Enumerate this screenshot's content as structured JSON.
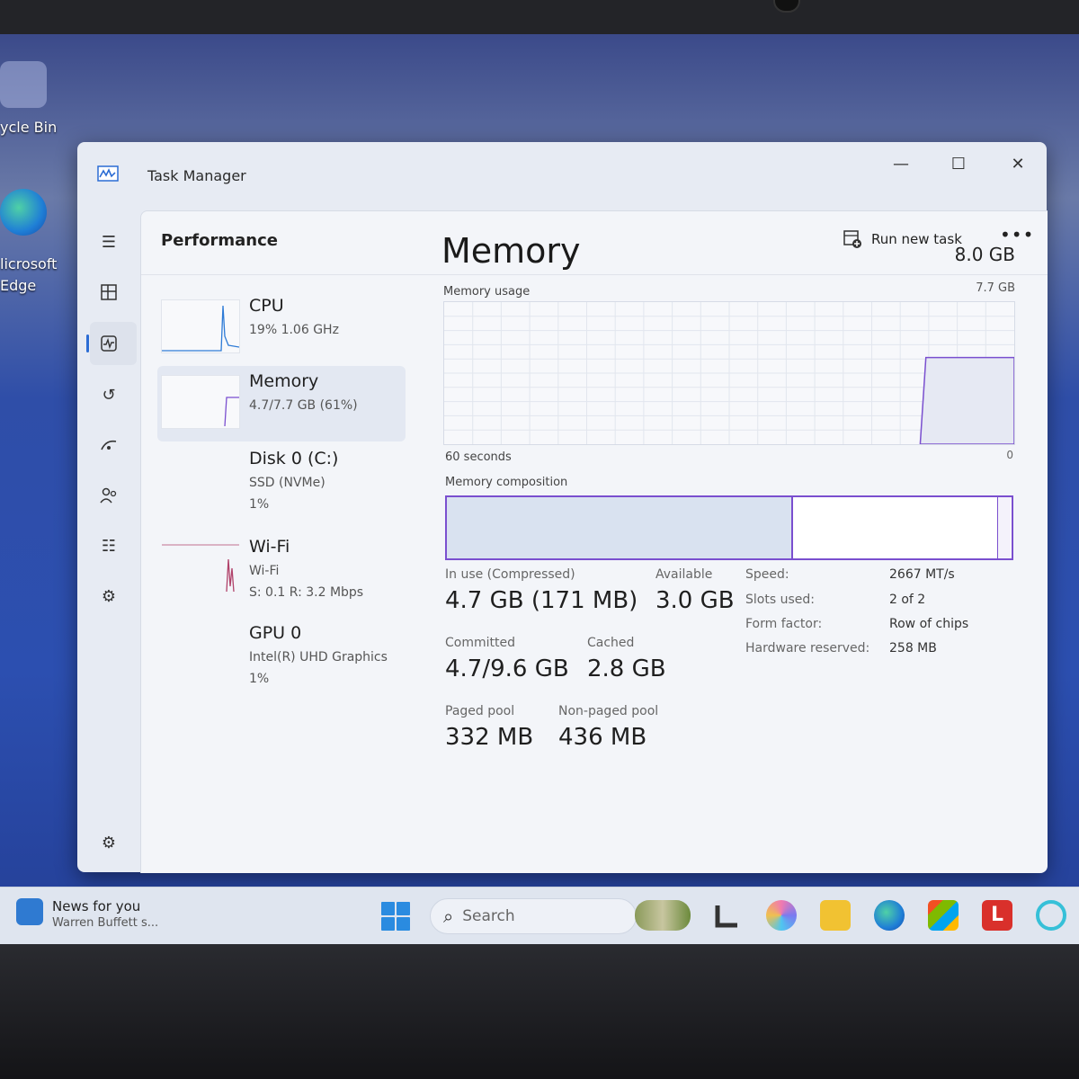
{
  "desktop": {
    "icons": [
      {
        "label": "ycle Bin"
      },
      {
        "label": "licrosoft\nEdge"
      }
    ]
  },
  "window": {
    "title": "Task Manager",
    "controls": {
      "minimize": "—",
      "maximize": "☐",
      "close": "✕"
    }
  },
  "page": {
    "title": "Performance",
    "run_new_task": "Run new task",
    "more": "•••"
  },
  "resources": [
    {
      "name": "CPU",
      "line1": "19%  1.06 GHz",
      "line2": ""
    },
    {
      "name": "Memory",
      "line1": "4.7/7.7 GB (61%)",
      "line2": ""
    },
    {
      "name": "Disk 0 (C:)",
      "line1": "SSD (NVMe)",
      "line2": "1%"
    },
    {
      "name": "Wi-Fi",
      "line1": "Wi-Fi",
      "line2": "S: 0.1  R: 3.2 Mbps"
    },
    {
      "name": "GPU 0",
      "line1": "Intel(R) UHD Graphics",
      "line2": "1%"
    }
  ],
  "memory": {
    "title": "Memory",
    "total": "8.0 GB",
    "usage_label": "Memory usage",
    "usage_max": "7.7 GB",
    "graph_time": "60 seconds",
    "graph_zero": "0",
    "usage_fraction": 0.61,
    "composition_label": "Memory composition",
    "composition_inuse_fraction": 0.61,
    "composition_free_start_fraction": 0.975,
    "stats": {
      "in_use_label": "In use (Compressed)",
      "in_use_value": "4.7 GB (171 MB)",
      "available_label": "Available",
      "available_value": "3.0 GB",
      "committed_label": "Committed",
      "committed_value": "4.7/9.6 GB",
      "cached_label": "Cached",
      "cached_value": "2.8 GB",
      "paged_label": "Paged pool",
      "paged_value": "332 MB",
      "nonpaged_label": "Non-paged pool",
      "nonpaged_value": "436 MB"
    },
    "specs": [
      {
        "key": "Speed:",
        "value": "2667 MT/s"
      },
      {
        "key": "Slots used:",
        "value": "2 of 2"
      },
      {
        "key": "Form factor:",
        "value": "Row of chips"
      },
      {
        "key": "Hardware reserved:",
        "value": "258 MB"
      }
    ]
  },
  "taskbar": {
    "news_title": "News for you",
    "news_sub": "Warren Buffett s...",
    "search_placeholder": "Search"
  },
  "colors": {
    "accent": "#2b6cd4",
    "memory_purple": "#7a4fcf",
    "cpu_line": "#2e7bd6",
    "wifi_line": "#b0426a"
  }
}
